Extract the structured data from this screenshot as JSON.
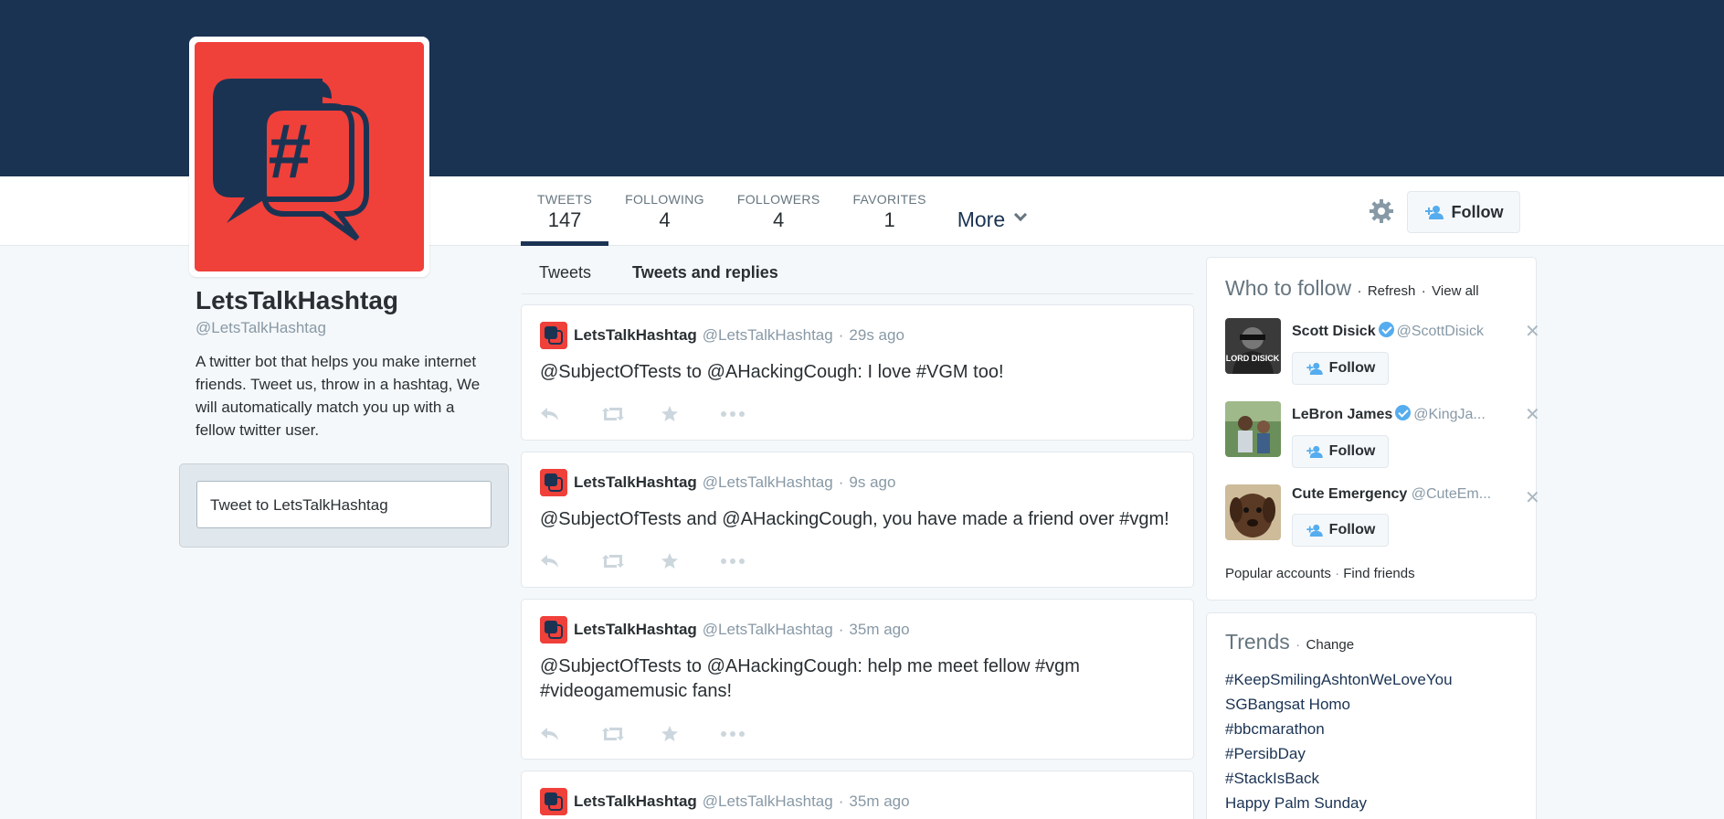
{
  "profile": {
    "name": "LetsTalkHashtag",
    "handle": "@LetsTalkHashtag",
    "bio": "A twitter bot that helps you make internet friends. Tweet us, throw in a hashtag, We will automatically match you up with a fellow twitter user."
  },
  "stats": [
    {
      "label": "TWEETS",
      "value": "147"
    },
    {
      "label": "FOLLOWING",
      "value": "4"
    },
    {
      "label": "FOLLOWERS",
      "value": "4"
    },
    {
      "label": "FAVORITES",
      "value": "1"
    }
  ],
  "more_label": "More",
  "follow_label": "Follow",
  "tweetbox": {
    "placeholder": "Tweet to LetsTalkHashtag"
  },
  "tabs": [
    "Tweets",
    "Tweets and replies"
  ],
  "tweets": [
    {
      "name": "LetsTalkHashtag",
      "handle": "@LetsTalkHashtag",
      "time": "29s ago",
      "text": "@SubjectOfTests to @AHackingCough: I love #VGM too!"
    },
    {
      "name": "LetsTalkHashtag",
      "handle": "@LetsTalkHashtag",
      "time": "9s ago",
      "text": "@SubjectOfTests and @AHackingCough, you have made a friend over #vgm!"
    },
    {
      "name": "LetsTalkHashtag",
      "handle": "@LetsTalkHashtag",
      "time": "35m ago",
      "text": "@SubjectOfTests to @AHackingCough: help me meet fellow #vgm #videogamemusic fans!"
    },
    {
      "name": "LetsTalkHashtag",
      "handle": "@LetsTalkHashtag",
      "time": "35m ago",
      "text": ""
    }
  ],
  "who_to_follow": {
    "title": "Who to follow",
    "refresh": "Refresh",
    "view_all": "View all",
    "accounts": [
      {
        "name": "Scott Disick",
        "handle": "@ScottDisick",
        "verified": true,
        "follow": "Follow",
        "avatar_text": "LORD DISICK"
      },
      {
        "name": "LeBron James",
        "handle": "@KingJa...",
        "verified": true,
        "follow": "Follow"
      },
      {
        "name": "Cute Emergency",
        "handle": "@CuteEm...",
        "verified": false,
        "follow": "Follow"
      }
    ],
    "popular": "Popular accounts",
    "find_friends": "Find friends",
    "separator": "·"
  },
  "trends": {
    "title": "Trends",
    "change": "Change",
    "items": [
      "#KeepSmilingAshtonWeLoveYou",
      "SGBangsat Homo",
      "#bbcmarathon",
      "#PersibDay",
      "#StackIsBack",
      "Happy Palm Sunday"
    ]
  },
  "icons": [
    "gear-icon",
    "add-person-icon",
    "reply-icon",
    "retweet-icon",
    "favorite-icon",
    "more-icon",
    "close-icon",
    "verified-icon",
    "chevron-down-icon"
  ],
  "colors": {
    "banner": "#1b3353",
    "avatar_bg": "#f0403a",
    "accent": "#55acee",
    "text": "#292f33",
    "muted": "#8899a6"
  }
}
